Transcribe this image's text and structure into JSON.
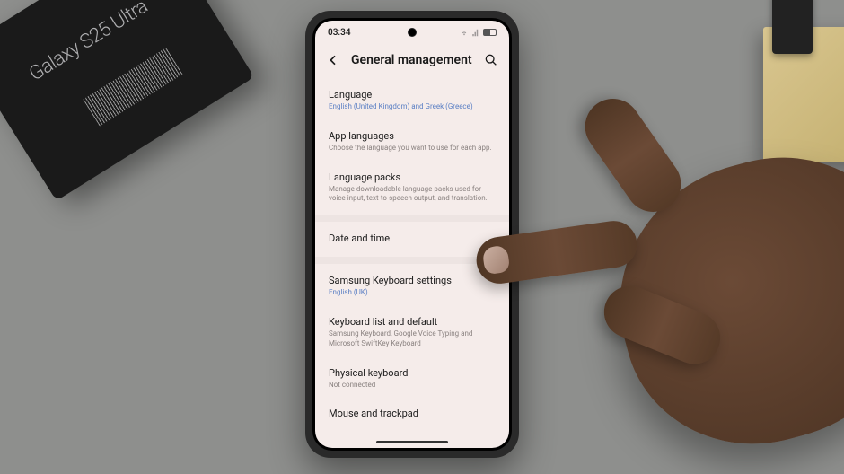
{
  "environment": {
    "product_box_label": "Galaxy S25 Ultra"
  },
  "status_bar": {
    "time": "03:34"
  },
  "header": {
    "title": "General management"
  },
  "settings": {
    "language": {
      "title": "Language",
      "subtitle": "English (United Kingdom) and Greek (Greece)"
    },
    "app_languages": {
      "title": "App languages",
      "subtitle": "Choose the language you want to use for each app."
    },
    "language_packs": {
      "title": "Language packs",
      "subtitle": "Manage downloadable language packs used for voice input, text-to-speech output, and translation."
    },
    "date_time": {
      "title": "Date and time"
    },
    "keyboard_settings": {
      "title": "Samsung Keyboard settings",
      "subtitle": "English (UK)"
    },
    "keyboard_list": {
      "title": "Keyboard list and default",
      "subtitle": "Samsung Keyboard, Google Voice Typing and Microsoft SwiftKey Keyboard"
    },
    "physical_keyboard": {
      "title": "Physical keyboard",
      "subtitle": "Not connected"
    },
    "mouse_trackpad": {
      "title": "Mouse and trackpad"
    }
  }
}
